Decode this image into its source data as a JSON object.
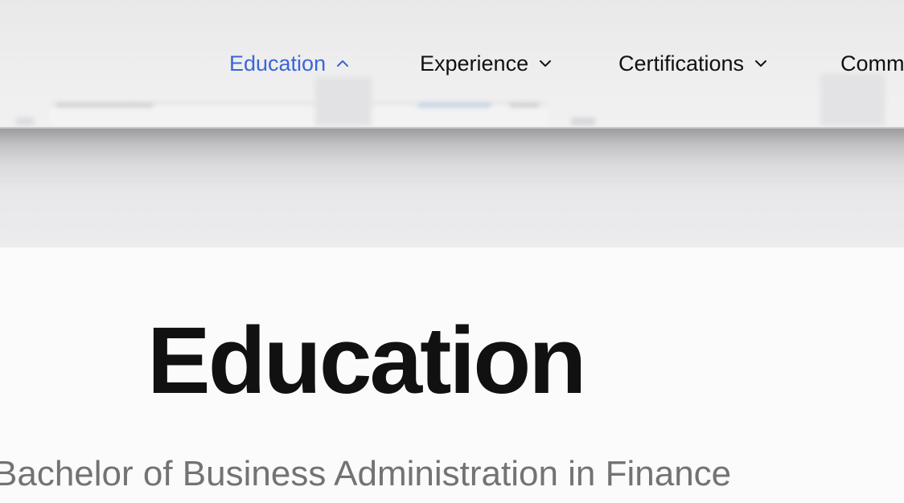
{
  "nav": {
    "items": [
      {
        "label": "Education",
        "state": "expanded",
        "active": true
      },
      {
        "label": "Experience",
        "state": "collapsed",
        "active": false
      },
      {
        "label": "Certifications",
        "state": "collapsed",
        "active": false
      },
      {
        "label": "Comm",
        "state": "collapsed",
        "active": false
      }
    ],
    "active_color": "#3a66d6",
    "text_color": "#111111"
  },
  "main": {
    "section_title": "Education",
    "degree": "Bachelor of Business Administration in Finance"
  },
  "icons": {
    "chevron_up": "chevron-up-icon",
    "chevron_down": "chevron-down-icon"
  }
}
